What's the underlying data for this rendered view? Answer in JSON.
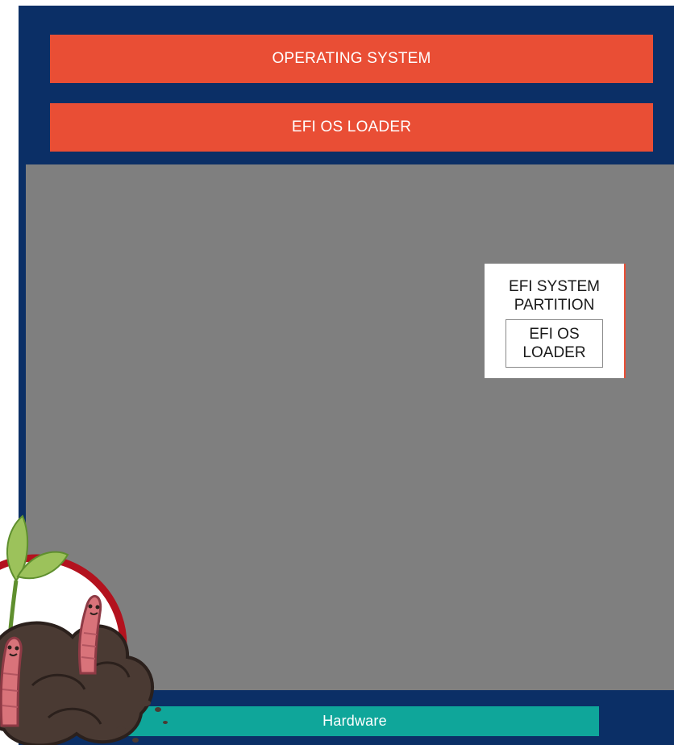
{
  "diagram": {
    "layers": {
      "operating_system": "OPERATING SYSTEM",
      "efi_os_loader": "EFI OS LOADER",
      "hardware": "Hardware"
    },
    "esp": {
      "title": "EFI SYSTEM PARTITION",
      "inner_label": "EFI OS LOADER"
    }
  },
  "colors": {
    "frame": "#0b2f66",
    "software_layer": "#e94e35",
    "firmware_area": "#7f7f7f",
    "hardware_layer": "#0fa69a"
  },
  "decorations": {
    "mascot_icon": "worms-in-soil-with-sprout-icon"
  }
}
